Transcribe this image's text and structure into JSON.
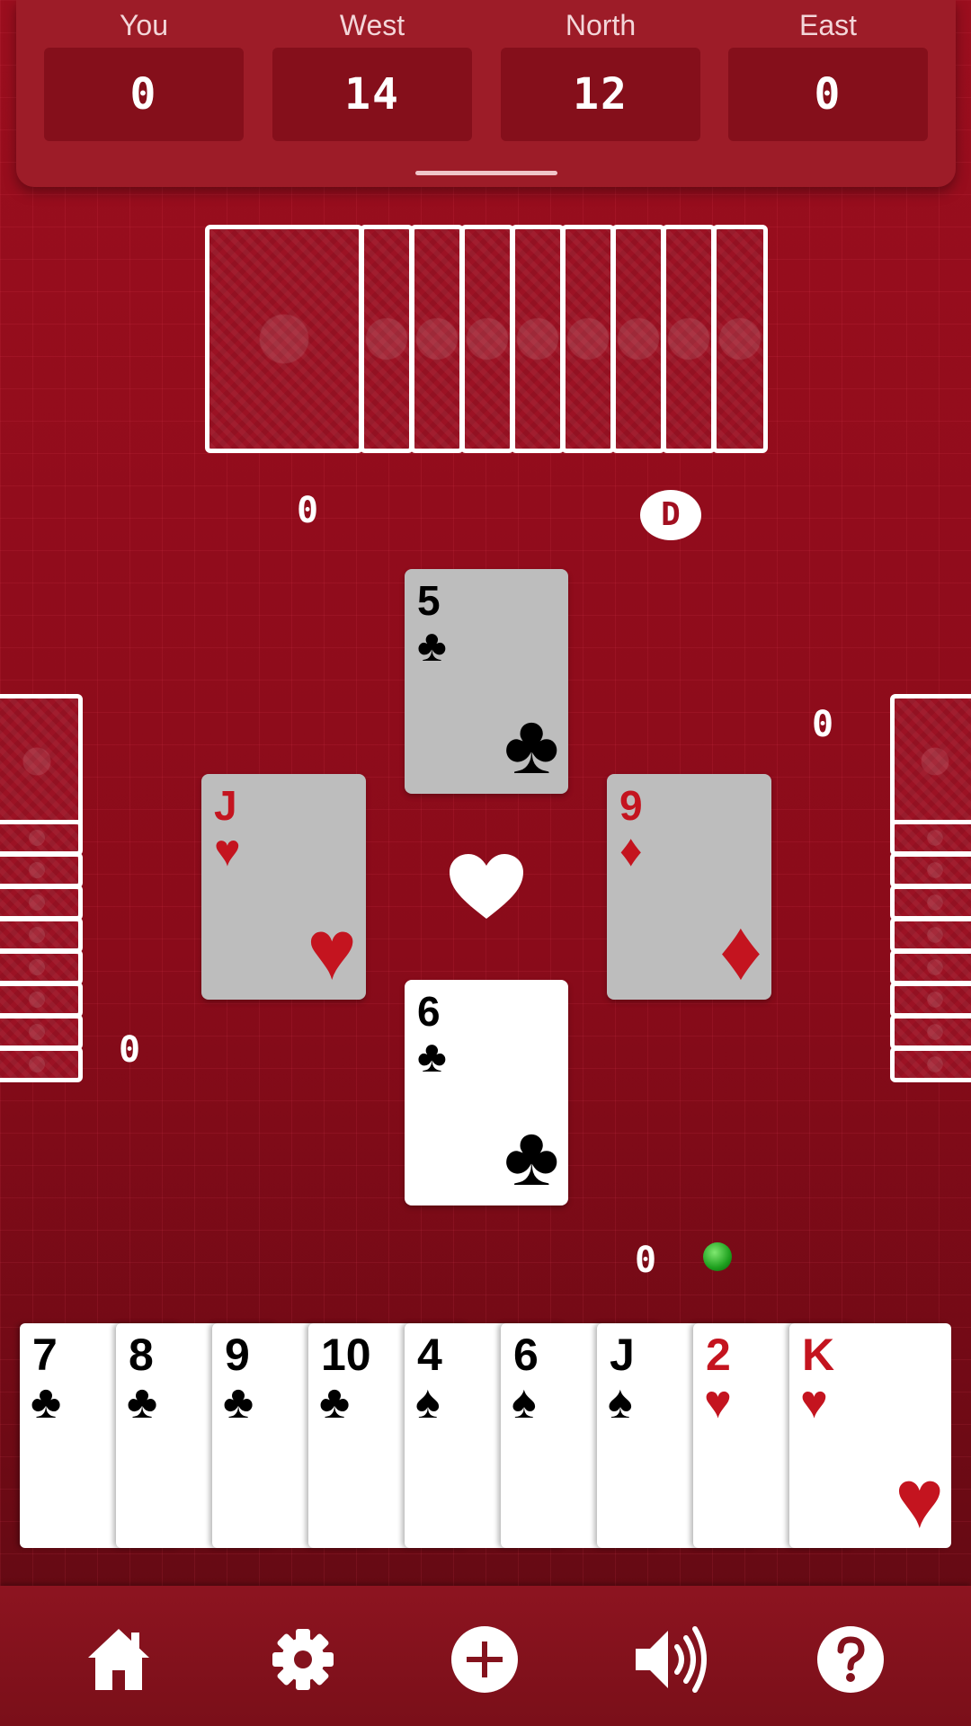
{
  "scoreboard": {
    "players": [
      {
        "name": "You",
        "score": "0"
      },
      {
        "name": "West",
        "score": "14"
      },
      {
        "name": "North",
        "score": "12"
      },
      {
        "name": "East",
        "score": "0"
      }
    ]
  },
  "table": {
    "north_tricks": "0",
    "dealer_label": "D",
    "east_tricks": "0",
    "west_tricks": "0",
    "south_tricks": "0",
    "trump_suit": "heart-icon"
  },
  "played_cards": {
    "north": {
      "rank": "5",
      "suit": "♣"
    },
    "west": {
      "rank": "J",
      "suit": "♥"
    },
    "east": {
      "rank": "9",
      "suit": "♦"
    },
    "south": {
      "rank": "6",
      "suit": "♣"
    }
  },
  "hand": [
    {
      "rank": "7",
      "suit": "♣"
    },
    {
      "rank": "8",
      "suit": "♣"
    },
    {
      "rank": "9",
      "suit": "♣"
    },
    {
      "rank": "10",
      "suit": "♣"
    },
    {
      "rank": "4",
      "suit": "♠"
    },
    {
      "rank": "6",
      "suit": "♠"
    },
    {
      "rank": "J",
      "suit": "♠"
    },
    {
      "rank": "2",
      "suit": "♥"
    },
    {
      "rank": "K",
      "suit": "♥"
    }
  ],
  "colors": {
    "table_red": "#9b0e1e",
    "card_red": "#c4141f",
    "indicator_green": "#1ea01e"
  },
  "nav": [
    "home-icon",
    "gear-icon",
    "plus-icon",
    "speaker-icon",
    "help-icon"
  ]
}
